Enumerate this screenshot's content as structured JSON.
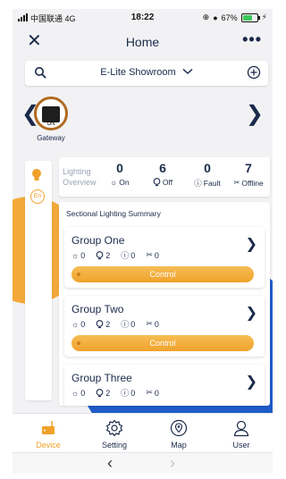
{
  "status": {
    "carrier": "中国联通",
    "network": "4G",
    "time": "18:22",
    "battery": "67%",
    "battery_level": 0.67
  },
  "header": {
    "title": "Home"
  },
  "location": {
    "name": "E-Lite Showroom"
  },
  "gateway": {
    "state": "ON",
    "label": "Gateway"
  },
  "overview": {
    "title": "Lighting Overview",
    "stats": [
      {
        "count": "0",
        "label": "On"
      },
      {
        "count": "6",
        "label": "Off"
      },
      {
        "count": "0",
        "label": "Fault"
      },
      {
        "count": "7",
        "label": "Offline"
      }
    ]
  },
  "side": {
    "lang": "En"
  },
  "summary": {
    "title": "Sectional Lighting Summary",
    "groups": [
      {
        "name": "Group One",
        "on": "0",
        "off": "2",
        "fault": "0",
        "offline": "0",
        "button": "Control"
      },
      {
        "name": "Group Two",
        "on": "0",
        "off": "2",
        "fault": "0",
        "offline": "0",
        "button": "Control"
      },
      {
        "name": "Group Three",
        "on": "0",
        "off": "2",
        "fault": "0",
        "offline": "0"
      }
    ]
  },
  "nav": {
    "items": [
      {
        "label": "Device",
        "icon": "device-icon",
        "active": true
      },
      {
        "label": "Setting",
        "icon": "gear-icon",
        "active": false
      },
      {
        "label": "Map",
        "icon": "map-pin-icon",
        "active": false
      },
      {
        "label": "User",
        "icon": "user-icon",
        "active": false
      }
    ]
  },
  "colors": {
    "accent": "#f1a12b",
    "primary_text": "#1b2a4a",
    "blue_background": "#1f5bc7"
  }
}
